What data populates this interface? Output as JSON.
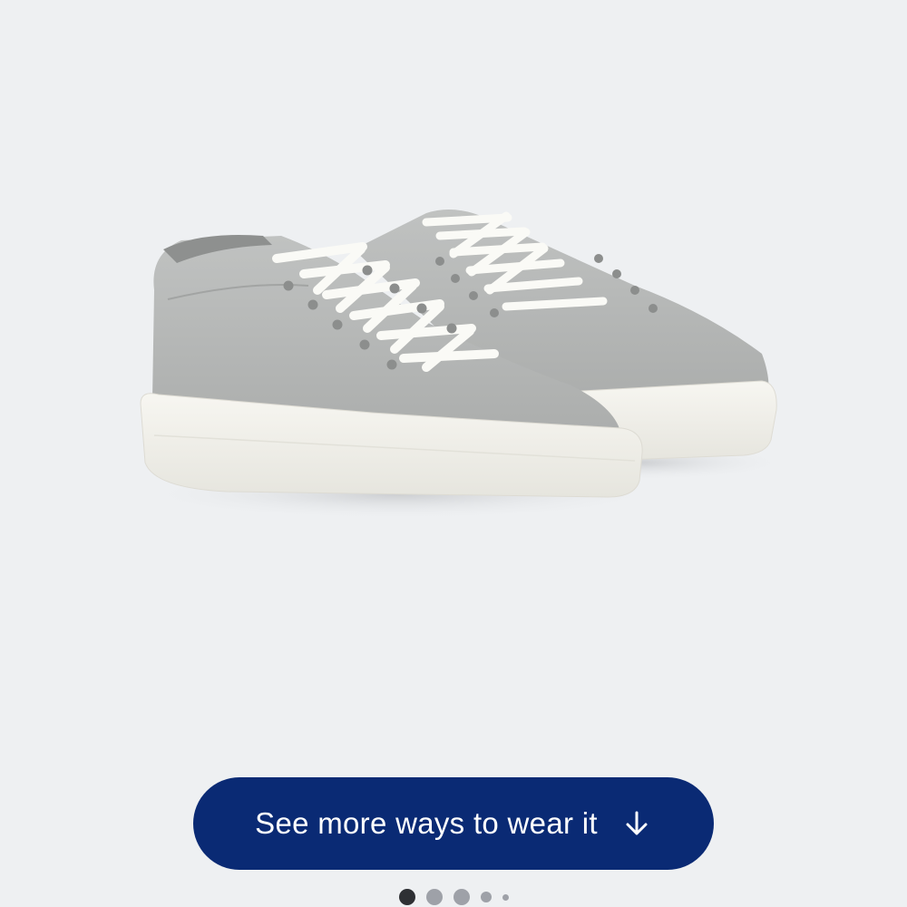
{
  "product": {
    "image_alt": "Grey canvas low-top sneakers with white laces and white soles",
    "colors": {
      "upper": "#b6b8b7",
      "upper_shade": "#9d9f9e",
      "sole": "#f1f0ea",
      "laces": "#fafaf6",
      "background": "#eef0f2"
    }
  },
  "cta": {
    "label": "See more ways to wear it",
    "icon": "arrow-down-icon",
    "background": "#0a2a74"
  },
  "carousel": {
    "total_dots": 5,
    "active_index": 0
  }
}
